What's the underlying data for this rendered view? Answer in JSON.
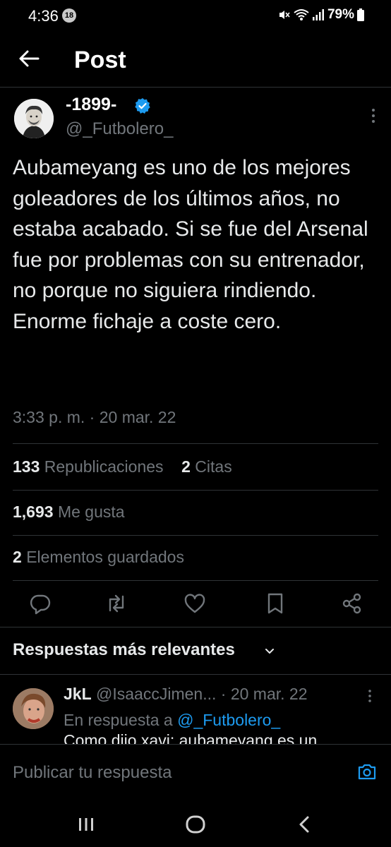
{
  "status_bar": {
    "time": "4:36",
    "notification_count": "18",
    "battery": "79%"
  },
  "header": {
    "title": "Post"
  },
  "post": {
    "author_name": "-1899-",
    "author_handle": "@_Futbolero_",
    "text": "Aubameyang es uno de los mejores goleadores de los últimos años, no estaba acabado. Si se fue del Arsenal fue por problemas con su entrenador, no porque no siguiera rindiendo. Enorme fichaje a coste cero.",
    "timestamp": "3:33 p. m. · 20 mar. 22",
    "stats": {
      "reposts_count": "133",
      "reposts_label": "Republicaciones",
      "quotes_count": "2",
      "quotes_label": "Citas",
      "likes_count": "1,693",
      "likes_label": "Me gusta",
      "bookmarks_count": "2",
      "bookmarks_label": "Elementos guardados"
    }
  },
  "replies": {
    "sort_label": "Respuestas más relevantes",
    "items": [
      {
        "name": "JkL",
        "handle": "@IsaaccJimen...",
        "date": "· 20 mar. 22",
        "reply_to_prefix": "En respuesta a",
        "reply_to_handle": "@_Futbolero_",
        "text_preview": "Como dijo xavi: aubameyang es un"
      }
    ]
  },
  "compose": {
    "placeholder": "Publicar tu respuesta"
  },
  "colors": {
    "background": "#000000",
    "text_primary": "#e7e9ea",
    "text_secondary": "#71767b",
    "accent": "#1d9bf0",
    "divider": "#2f3336"
  },
  "icons": {
    "back": "arrow-left-icon",
    "verified": "verified-badge-icon",
    "more": "more-vertical-icon",
    "reply": "reply-icon",
    "repost": "repost-icon",
    "like": "heart-icon",
    "bookmark": "bookmark-icon",
    "share": "share-icon",
    "camera": "camera-icon"
  }
}
